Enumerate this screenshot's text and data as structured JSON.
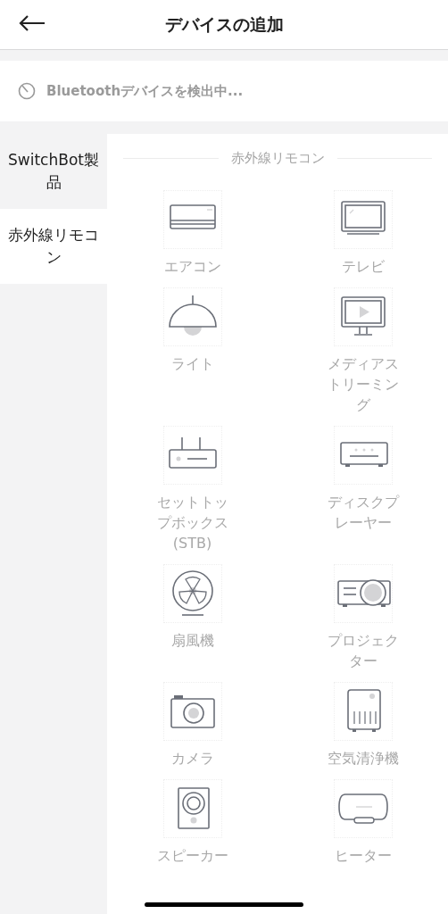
{
  "header": {
    "title": "デバイスの追加"
  },
  "scan": {
    "text": "Bluetoothデバイスを検出中..."
  },
  "sidebar": {
    "items": [
      {
        "label": "SwitchBot製品",
        "selected": false
      },
      {
        "label": "赤外線リモコン",
        "selected": true
      }
    ]
  },
  "section": {
    "title": "赤外線リモコン"
  },
  "devices": [
    {
      "kind": "aircon",
      "label": "エアコン"
    },
    {
      "kind": "tv",
      "label": "テレビ"
    },
    {
      "kind": "light",
      "label": "ライト"
    },
    {
      "kind": "media",
      "label": "メディアストリーミング"
    },
    {
      "kind": "stb",
      "label": "セットトップボックス(STB)"
    },
    {
      "kind": "disc",
      "label": "ディスクプレーヤー"
    },
    {
      "kind": "fan",
      "label": "扇風機"
    },
    {
      "kind": "projector",
      "label": "プロジェクター"
    },
    {
      "kind": "camera",
      "label": "カメラ"
    },
    {
      "kind": "purifier",
      "label": "空気清浄機"
    },
    {
      "kind": "speaker",
      "label": "スピーカー"
    },
    {
      "kind": "heater",
      "label": "ヒーター"
    }
  ]
}
